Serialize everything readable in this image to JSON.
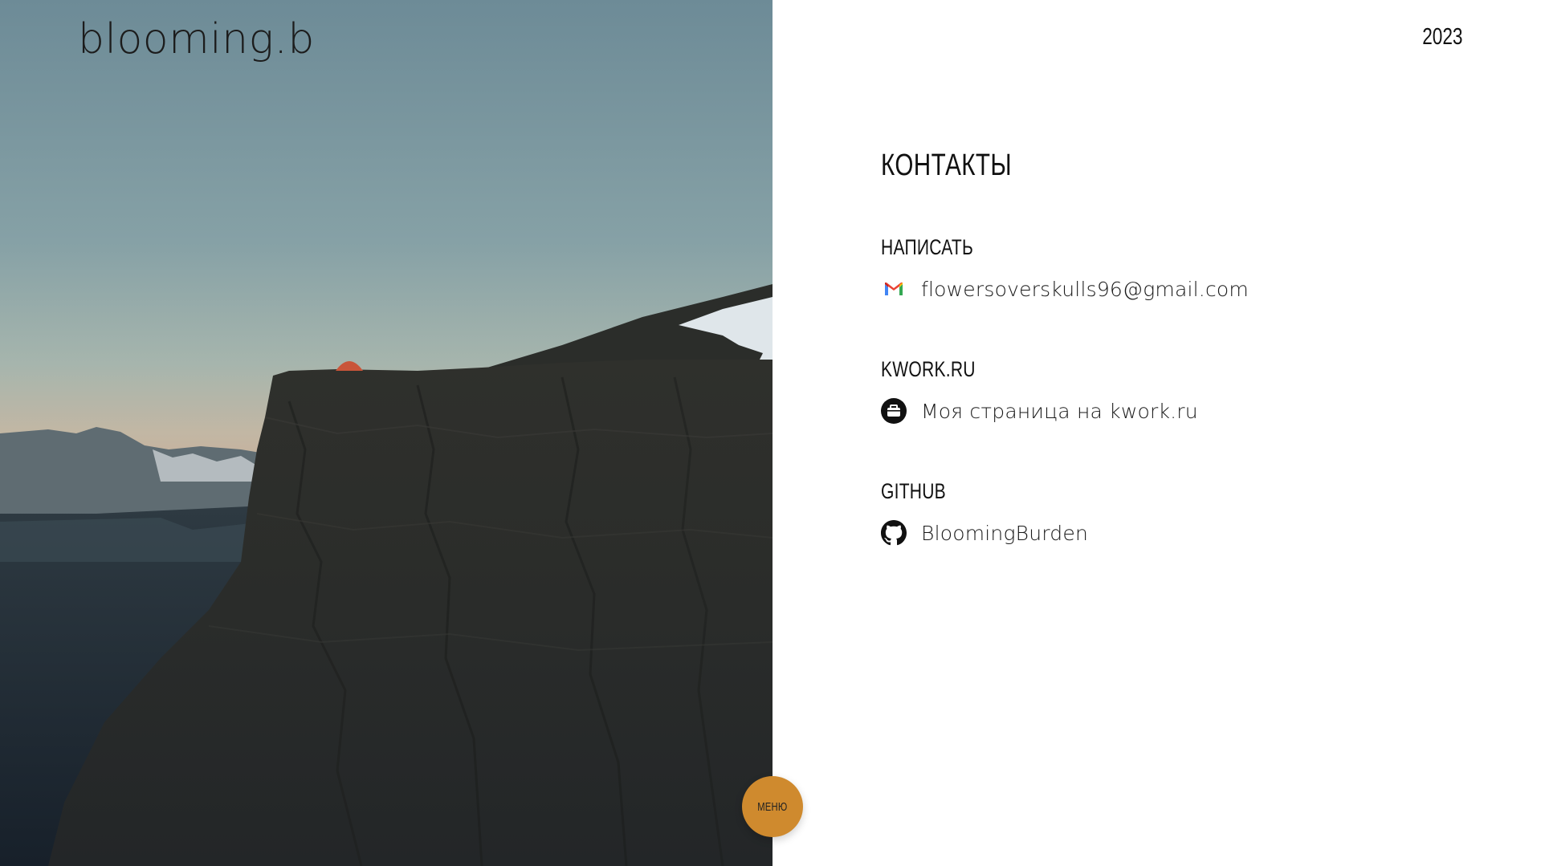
{
  "brand": {
    "logo_text": "blooming.b"
  },
  "header": {
    "year": "2023"
  },
  "contacts": {
    "title": "КОНТАКТЫ",
    "sections": [
      {
        "title": "НАПИСАТЬ",
        "icon": "gmail-icon",
        "link_text": "flowersoverskulls96@gmail.com"
      },
      {
        "title": "KWORK.RU",
        "icon": "briefcase-icon",
        "link_text": "Моя страница на kwork.ru"
      },
      {
        "title": "GITHUB",
        "icon": "github-icon",
        "link_text": "BloomingBurden"
      }
    ]
  },
  "menu": {
    "label": "МЕНЮ"
  },
  "colors": {
    "accent": "#cf8a2e",
    "text": "#111111",
    "background": "#ffffff"
  }
}
